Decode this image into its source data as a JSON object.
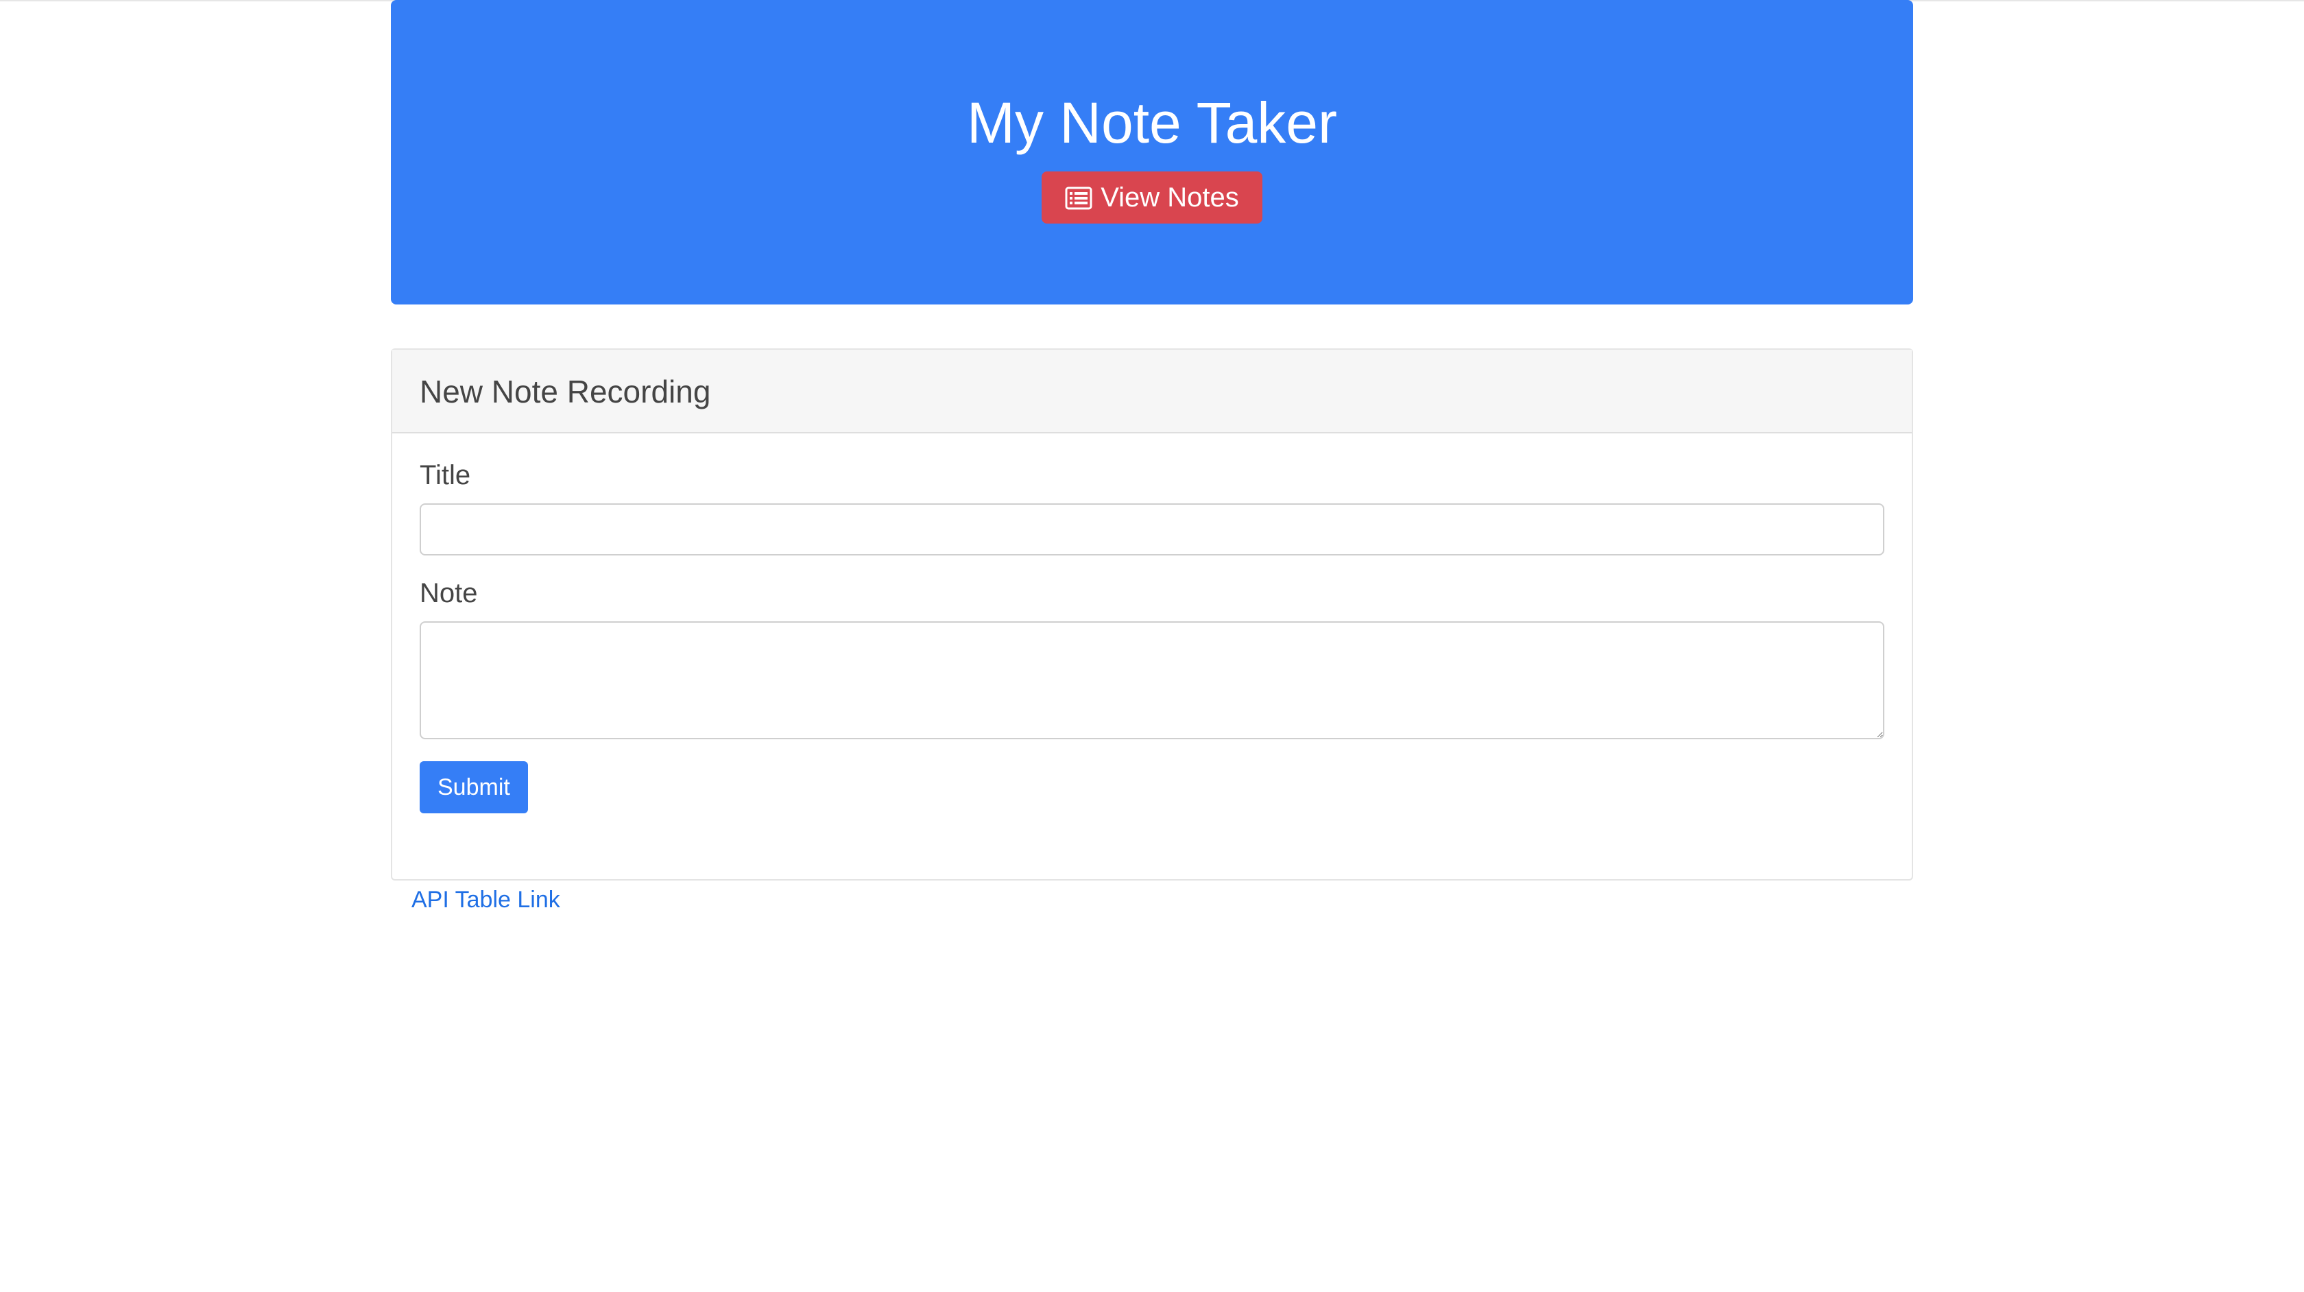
{
  "header": {
    "title": "My Note Taker",
    "view_notes_label": "View Notes",
    "view_notes_icon": "list-alt-icon"
  },
  "form": {
    "card_title": "New Note Recording",
    "title_label": "Title",
    "title_value": "",
    "note_label": "Note",
    "note_value": "",
    "submit_label": "Submit"
  },
  "footer": {
    "api_link_label": "API Table Link"
  },
  "colors": {
    "primary": "#357ef6",
    "danger": "#d9454f",
    "link": "#1f6fe5"
  }
}
